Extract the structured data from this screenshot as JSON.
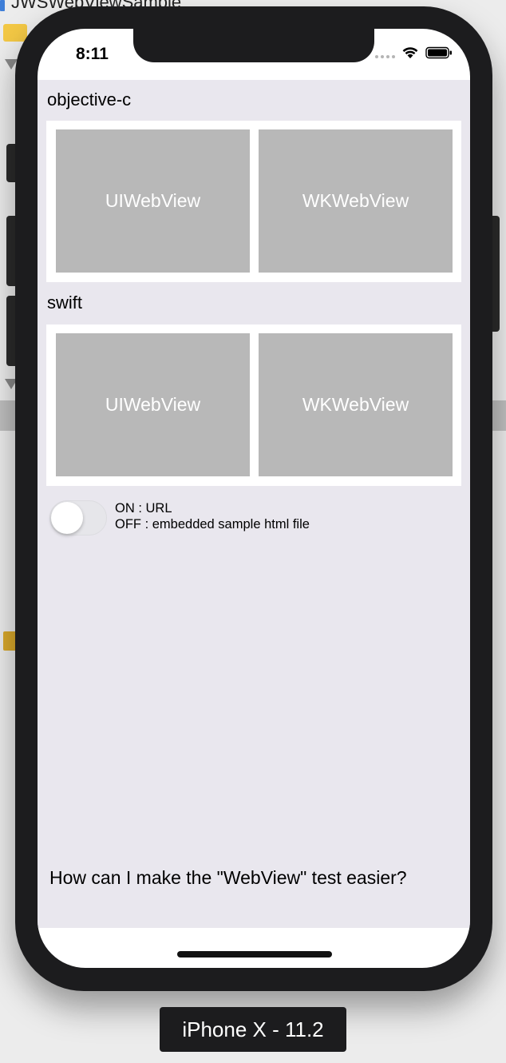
{
  "background": {
    "project_title": "JWSWebViewSample"
  },
  "status_bar": {
    "time": "8:11"
  },
  "objc_section": {
    "title": "objective-c",
    "buttons": [
      {
        "label": "UIWebView"
      },
      {
        "label": "WKWebView"
      }
    ]
  },
  "swift_section": {
    "title": "swift",
    "buttons": [
      {
        "label": "UIWebView"
      },
      {
        "label": "WKWebView"
      }
    ]
  },
  "toggle": {
    "state": "off",
    "on_label": "ON : URL",
    "off_label": "OFF : embedded sample html file"
  },
  "question": "How can I make the \"WebView\" test easier?",
  "device_label": "iPhone X - 11.2",
  "colors": {
    "button_gray": "#b8b8b8",
    "content_background": "#e9e7ee",
    "phone_frame": "#1c1c1e"
  }
}
